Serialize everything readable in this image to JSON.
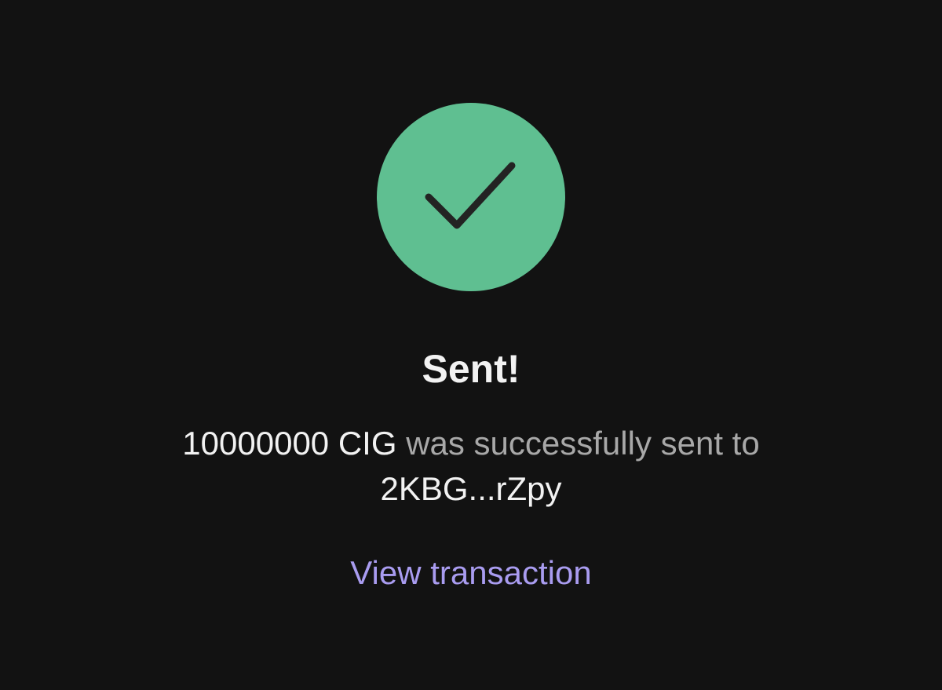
{
  "status": {
    "icon": "check-icon",
    "color": "#5fbf91"
  },
  "title": "Sent!",
  "message": {
    "amount": "10000000 CIG",
    "text": "was successfully sent to",
    "recipient": "2KBG...rZpy"
  },
  "actions": {
    "view_transaction": "View transaction",
    "link_color": "#a99cf0"
  }
}
